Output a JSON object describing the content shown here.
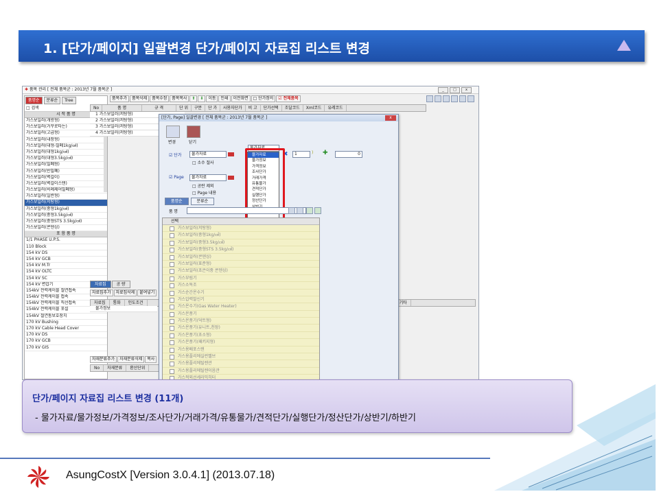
{
  "banner": {
    "title": "1. [단가/페이지] 일괄변경 단가/페이지 자료집 리스트 변경"
  },
  "app": {
    "window_title": "품목 관리 [ 전체 품목군 : 2013년 7월 품목군 ]",
    "left_tabs": [
      "품명순",
      "분류순",
      "Tree"
    ],
    "search_label": "검색",
    "group1": "시 작 품 명",
    "items1": [
      "가스보일러(개방형)",
      "가스보일러(거꾸로타는)",
      "가스보일러(고급형)",
      "가스보일러(내장형)",
      "가스보일러(대형-밀폐1kg/㎠)",
      "가스보일러(대형1kg/㎠)",
      "가스보일러(대형3.5kg/㎠)",
      "가스보일러(밀폐형)",
      "가스보일러(반밀폐)",
      "가스보일러(벽걸이)",
      "가스보일러(벽걸이스탠)",
      "가스보일러(비례제어밀폐형)",
      "가스보일러(일반형)",
      "가스보일러(저탕형)",
      "가스보일러(중형1kg/㎠)",
      "가스보일러(중형3.5kg/㎠)",
      "가스보일러(중형STS 3.5kg/㎠)",
      "가스보일러(콘덴싱)"
    ],
    "selected_item": "가스보일러(저탕형)",
    "group2": "포 함 품 명",
    "items2": [
      "1/1 PHASE U.P.S.",
      "110 Block",
      "154 kV DS",
      "154 kV GCB",
      "154 kV M.Tr",
      "154 kV OLTC",
      "154 kV SC",
      "154 kV 변압기",
      "154kV 전력케이블 절연접속",
      "154kV 전력케이블 접속",
      "154kV 전력케이블 직선접속",
      "154kV 전력케이블 포설",
      "154kV 절연통보호장치",
      "170 kV Bushing",
      "170 kV Cable Head Cover",
      "170 kV DS",
      "170 kV GCB",
      "170 kV GIS"
    ],
    "toolbar": [
      "품목추가",
      "품목삭제",
      "품목수정",
      "품목복사",
      "이동",
      "인쇄",
      "이전화면",
      "단가정의",
      "전체품목"
    ],
    "grid_headers": [
      "No",
      "품 명",
      "규 격",
      "단 위",
      "구분",
      "단 가",
      "사용자단가",
      "비 고",
      "단가선택",
      "조달코드",
      "Xml코드",
      "유레코드"
    ],
    "grid_rows": [
      "1  가스보일러(저탕형)",
      "2  가스보일러(저탕형)",
      "3  가스보일러(저탕형)",
      "4  가스보일러(저탕형)"
    ],
    "bottom_tabs": [
      "자료집",
      "공 량"
    ],
    "bottom_toolbar": [
      "자료집추가",
      "자료집삭제",
      "붙여넣기"
    ],
    "bottom_headers": [
      "자료집",
      "통화",
      "인도조건",
      "제주",
      "기타"
    ],
    "bottom_row": "물가정보",
    "bottom2_toolbar": [
      "자재분류추가",
      "자재분류삭제",
      "복사"
    ],
    "bottom2_headers": [
      "No",
      "자재분류",
      "환산단위",
      "환산계"
    ]
  },
  "dialog": {
    "title": "[단가, Page] 일괄변경 [ 전체 품목군 : 2013년 7월 품목군 ]",
    "change_label": "변경",
    "close_label": "닫기",
    "price_check": "단가",
    "price_combo": "물가자료",
    "decimal_check": "소수 절사",
    "page_check": "Page",
    "page_combo": "물가자료",
    "blank_check": "공란 제외",
    "page_content_check": "Page 내용",
    "spin1": "1",
    "spin2": "0",
    "dropdown_current": "물가자료",
    "dropdown_options": [
      "물가자료",
      "물가정보",
      "가격정보",
      "조사단가",
      "거래가격",
      "유통물가",
      "견적단가",
      "실행단가",
      "정산단가",
      "상반기",
      "하반기"
    ],
    "tabs": [
      "품명순",
      "분류순"
    ],
    "name_label": "품 명",
    "list_header": "선택",
    "list_items": [
      "가스보일러(저탕형)",
      "가스보일러(중형1kg/㎠)",
      "가스보일러(중형3.5kg/㎠)",
      "가스보일러(중형STS 3.5kg/㎠)",
      "가스보일러(콘덴싱)",
      "가스보일러(표준형)",
      "가스보일러(초은이중 콘덴싱)",
      "가스부림기",
      "가스소독조",
      "가스순간온수기",
      "가스압력발신기",
      "가스온수기(Gas Water Heater)",
      "가스온풍기",
      "가스온풍기(덕트형)",
      "가스온풍기(유니트,천장)",
      "가스온풍기(초소형)",
      "가스온풍기(패키지형)",
      "가스용배포스탠",
      "가스용플리에실런밸브",
      "가스용플리에틸렌관",
      "가스용플리에틸렌이음관",
      "가스적외선세라믹히터"
    ]
  },
  "callout": {
    "title": "단가/페이지 자료집 리스트 변경  (11개)",
    "subtitle": " - 물가자료/물가정보/가격정보/조사단가/거래가격/유통물가/견적단가/실행단가/정산단가/상반기/하반기"
  },
  "footer": {
    "text": "AsungCostX   [Version 3.0.4.1]    (2013.07.18)"
  },
  "colors": {
    "banner": "#2f6fd1",
    "accent_red": "#e0161d",
    "callout_bg": "#dcd4f0"
  }
}
